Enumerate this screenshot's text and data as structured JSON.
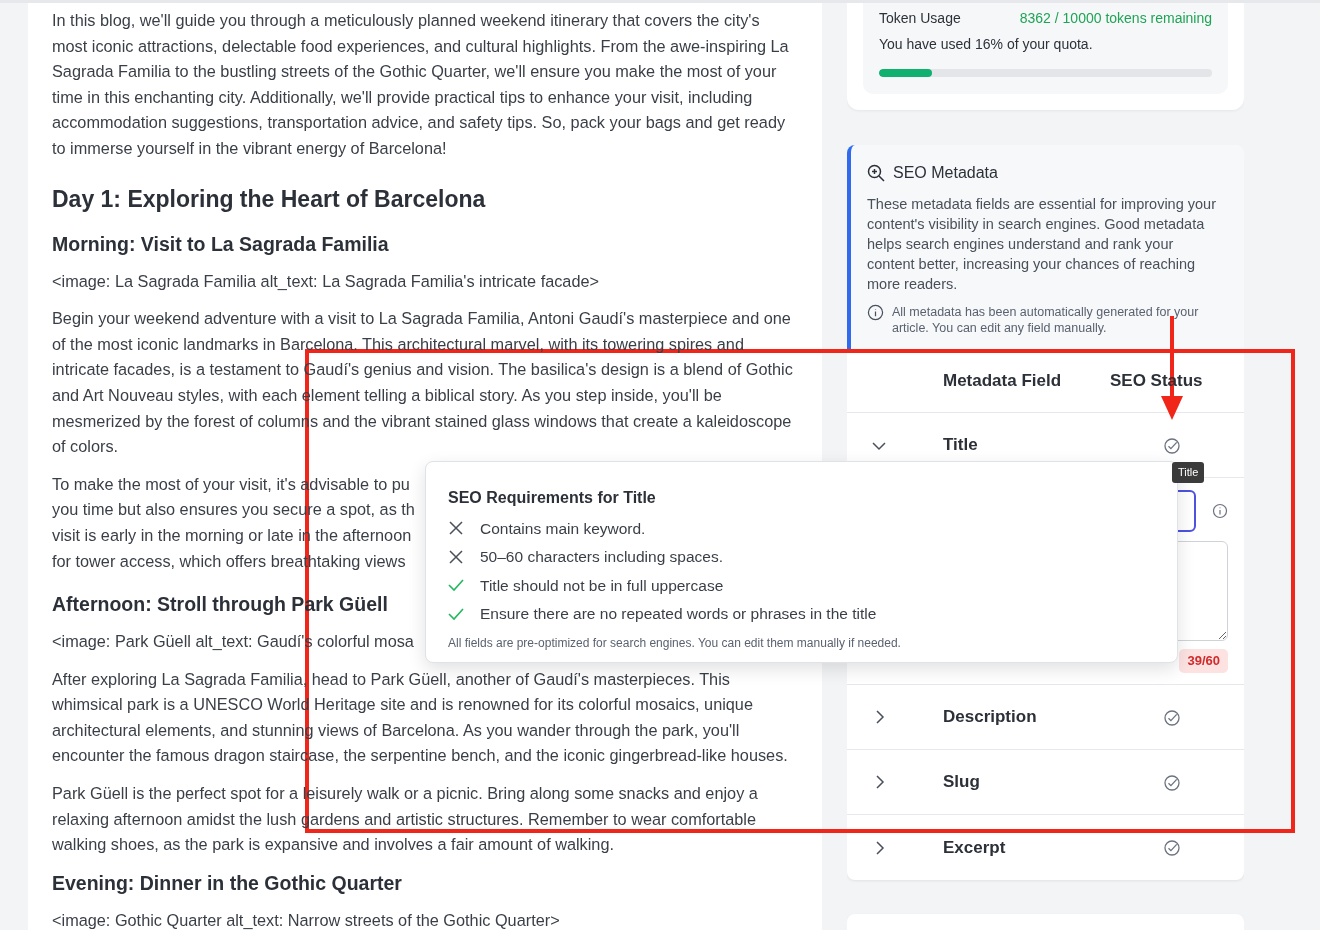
{
  "article": {
    "blocks": [
      {
        "kind": "paragraph",
        "text": "In this blog, we'll guide you through a meticulously planned weekend itinerary that covers the city's most iconic attractions, delectable food experiences, and cultural highlights. From the awe-inspiring La Sagrada Familia to the bustling streets of the Gothic Quarter, we'll ensure you make the most of your time in this enchanting city. Additionally, we'll provide practical tips to enhance your visit, including accommodation suggestions, transportation advice, and safety tips. So, pack your bags and get ready to immerse yourself in the vibrant energy of Barcelona!"
      },
      {
        "kind": "heading",
        "text": "Day 1: Exploring the Heart of Barcelona"
      },
      {
        "kind": "subheading",
        "text": "Morning: Visit to La Sagrada Familia"
      },
      {
        "kind": "image_note",
        "text": "<image: La Sagrada Familia alt_text: La Sagrada Familia's intricate facade>"
      },
      {
        "kind": "paragraph",
        "text": "Begin your weekend adventure with a visit to La Sagrada Familia, Antoni Gaudí's masterpiece and one of the most iconic landmarks in Barcelona. This architectural marvel, with its towering spires and intricate facades, is a testament to Gaudí's genius and vision. The basilica's design is a blend of Gothic and Art Nouveau styles, with each element telling a biblical story. As you step inside, you'll be mesmerized by the forest of columns and the vibrant stained glass windows that create a kaleidoscope of colors."
      },
      {
        "kind": "cut_paragraph",
        "lines": [
          "To make the most of your visit, it's advisable to pu",
          "you time but also ensures you secure a spot, as th",
          "visit is early in the morning or late in the afternoon",
          "for tower access, which offers breathtaking views"
        ]
      },
      {
        "kind": "subheading",
        "text": "Afternoon: Stroll through Park Güell"
      },
      {
        "kind": "image_note",
        "text": "<image: Park Güell alt_text: Gaudí's colorful mosa"
      },
      {
        "kind": "paragraph",
        "text": "After exploring La Sagrada Familia, head to Park Güell, another of Gaudí's masterpieces. This whimsical park is a UNESCO World Heritage site and is renowned for its colorful mosaics, unique architectural elements, and stunning views of Barcelona. As you wander through the park, you'll encounter the famous dragon staircase, the serpentine bench, and the iconic gingerbread-like houses."
      },
      {
        "kind": "paragraph",
        "text": "Park Güell is the perfect spot for a leisurely walk or a picnic. Bring along some snacks and enjoy a relaxing afternoon amidst the lush gardens and artistic structures. Remember to wear comfortable walking shoes, as the park is expansive and involves a fair amount of walking."
      },
      {
        "kind": "subheading",
        "text": "Evening: Dinner in the Gothic Quarter"
      },
      {
        "kind": "image_note",
        "text": "<image: Gothic Quarter alt_text: Narrow streets of the Gothic Quarter>"
      }
    ]
  },
  "token_usage": {
    "label": "Token Usage",
    "remaining": "8362 / 10000 tokens remaining",
    "note": "You have used 16% of your quota.",
    "level": 0.16
  },
  "seo_metadata": {
    "title": "SEO Metadata",
    "description": "These metadata fields are essential for improving your content's visibility in search engines. Good metadata helps search engines understand and rank your content better, increasing your chances of reaching more readers.",
    "info": "All metadata has been automatically generated for your article. You can edit any field manually."
  },
  "metadata_table": {
    "columns": [
      "Metadata Field",
      "SEO Status"
    ],
    "rows": [
      {
        "field": "Title",
        "expanded": true,
        "count": "39/60"
      },
      {
        "field": "Description",
        "expanded": false
      },
      {
        "field": "Slug",
        "expanded": false
      },
      {
        "field": "Excerpt",
        "expanded": false
      }
    ]
  },
  "popover": {
    "title": "SEO Requirements for Title",
    "requirements": [
      {
        "text": "Contains main keyword.",
        "met": false
      },
      {
        "text": "50–60 characters including spaces.",
        "met": false
      },
      {
        "text": "Title should not be in full uppercase",
        "met": true
      },
      {
        "text": "Ensure there are no repeated words or phrases in the title",
        "met": true
      }
    ],
    "footnote": "All fields are pre-optimized for search engines. You can edit them manually if needed."
  },
  "tooltip": {
    "text": "Title"
  }
}
